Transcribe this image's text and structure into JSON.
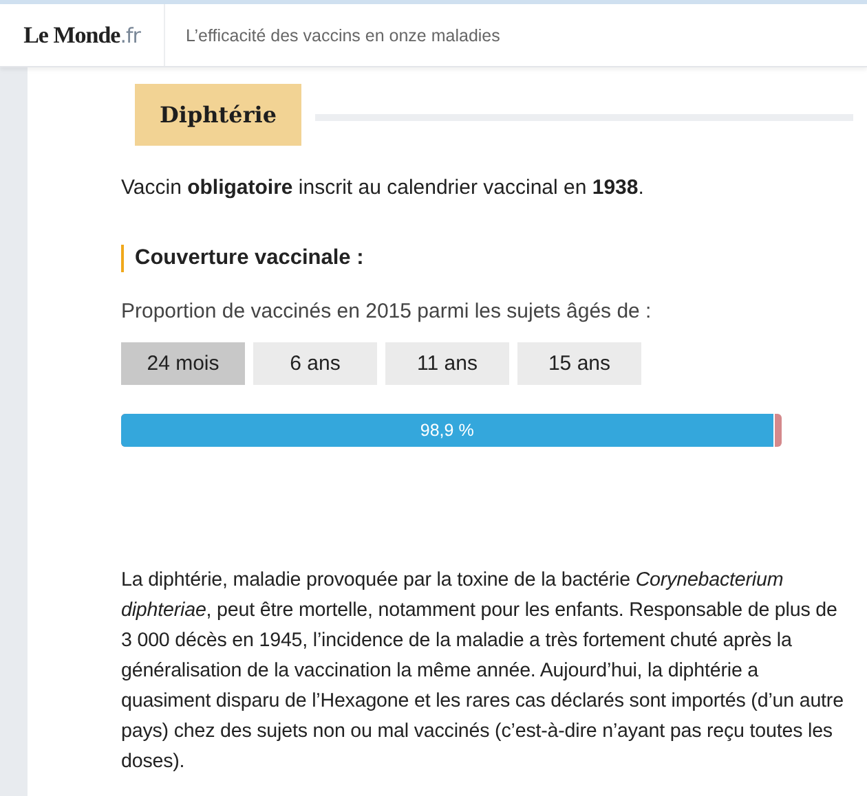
{
  "header": {
    "logo": {
      "name": "Le Monde",
      "suffix": ".fr"
    },
    "title": "L’efficacité des vaccins en onze maladies"
  },
  "section": {
    "tag": "Diphtérie",
    "intro": "Vaccin **obligatoire** inscrit au calendrier vaccinal en **1938**.",
    "coverage": {
      "heading": "Couverture vaccinale :",
      "caption": "Proportion de vaccinés en 2015 parmi les sujets âgés de :",
      "tabs": [
        {
          "label": "24 mois",
          "selected": true
        },
        {
          "label": "6 ans",
          "selected": false
        },
        {
          "label": "11 ans",
          "selected": false
        },
        {
          "label": "15 ans",
          "selected": false
        }
      ],
      "bar": {
        "level": 0.989,
        "reading": "98,9 %"
      }
    },
    "description": "La diphtérie, maladie provoquée par la toxine de la bactérie *Corynebacterium diphteriae*, peut être mortelle, notamment pour les enfants. Responsable de plus de 3 000 décès en 1945, l’incidence de la maladie a très fortement chuté après la généralisation de la vaccination la même année. Aujourd’hui, la diphtérie a quasiment disparu de l’Hexagone et les rares cas déclarés sont importés (d’un autre pays) chez des sujets non ou mal vaccinés (c’est-à-dire n’ayant pas reçu toutes les doses)."
  }
}
